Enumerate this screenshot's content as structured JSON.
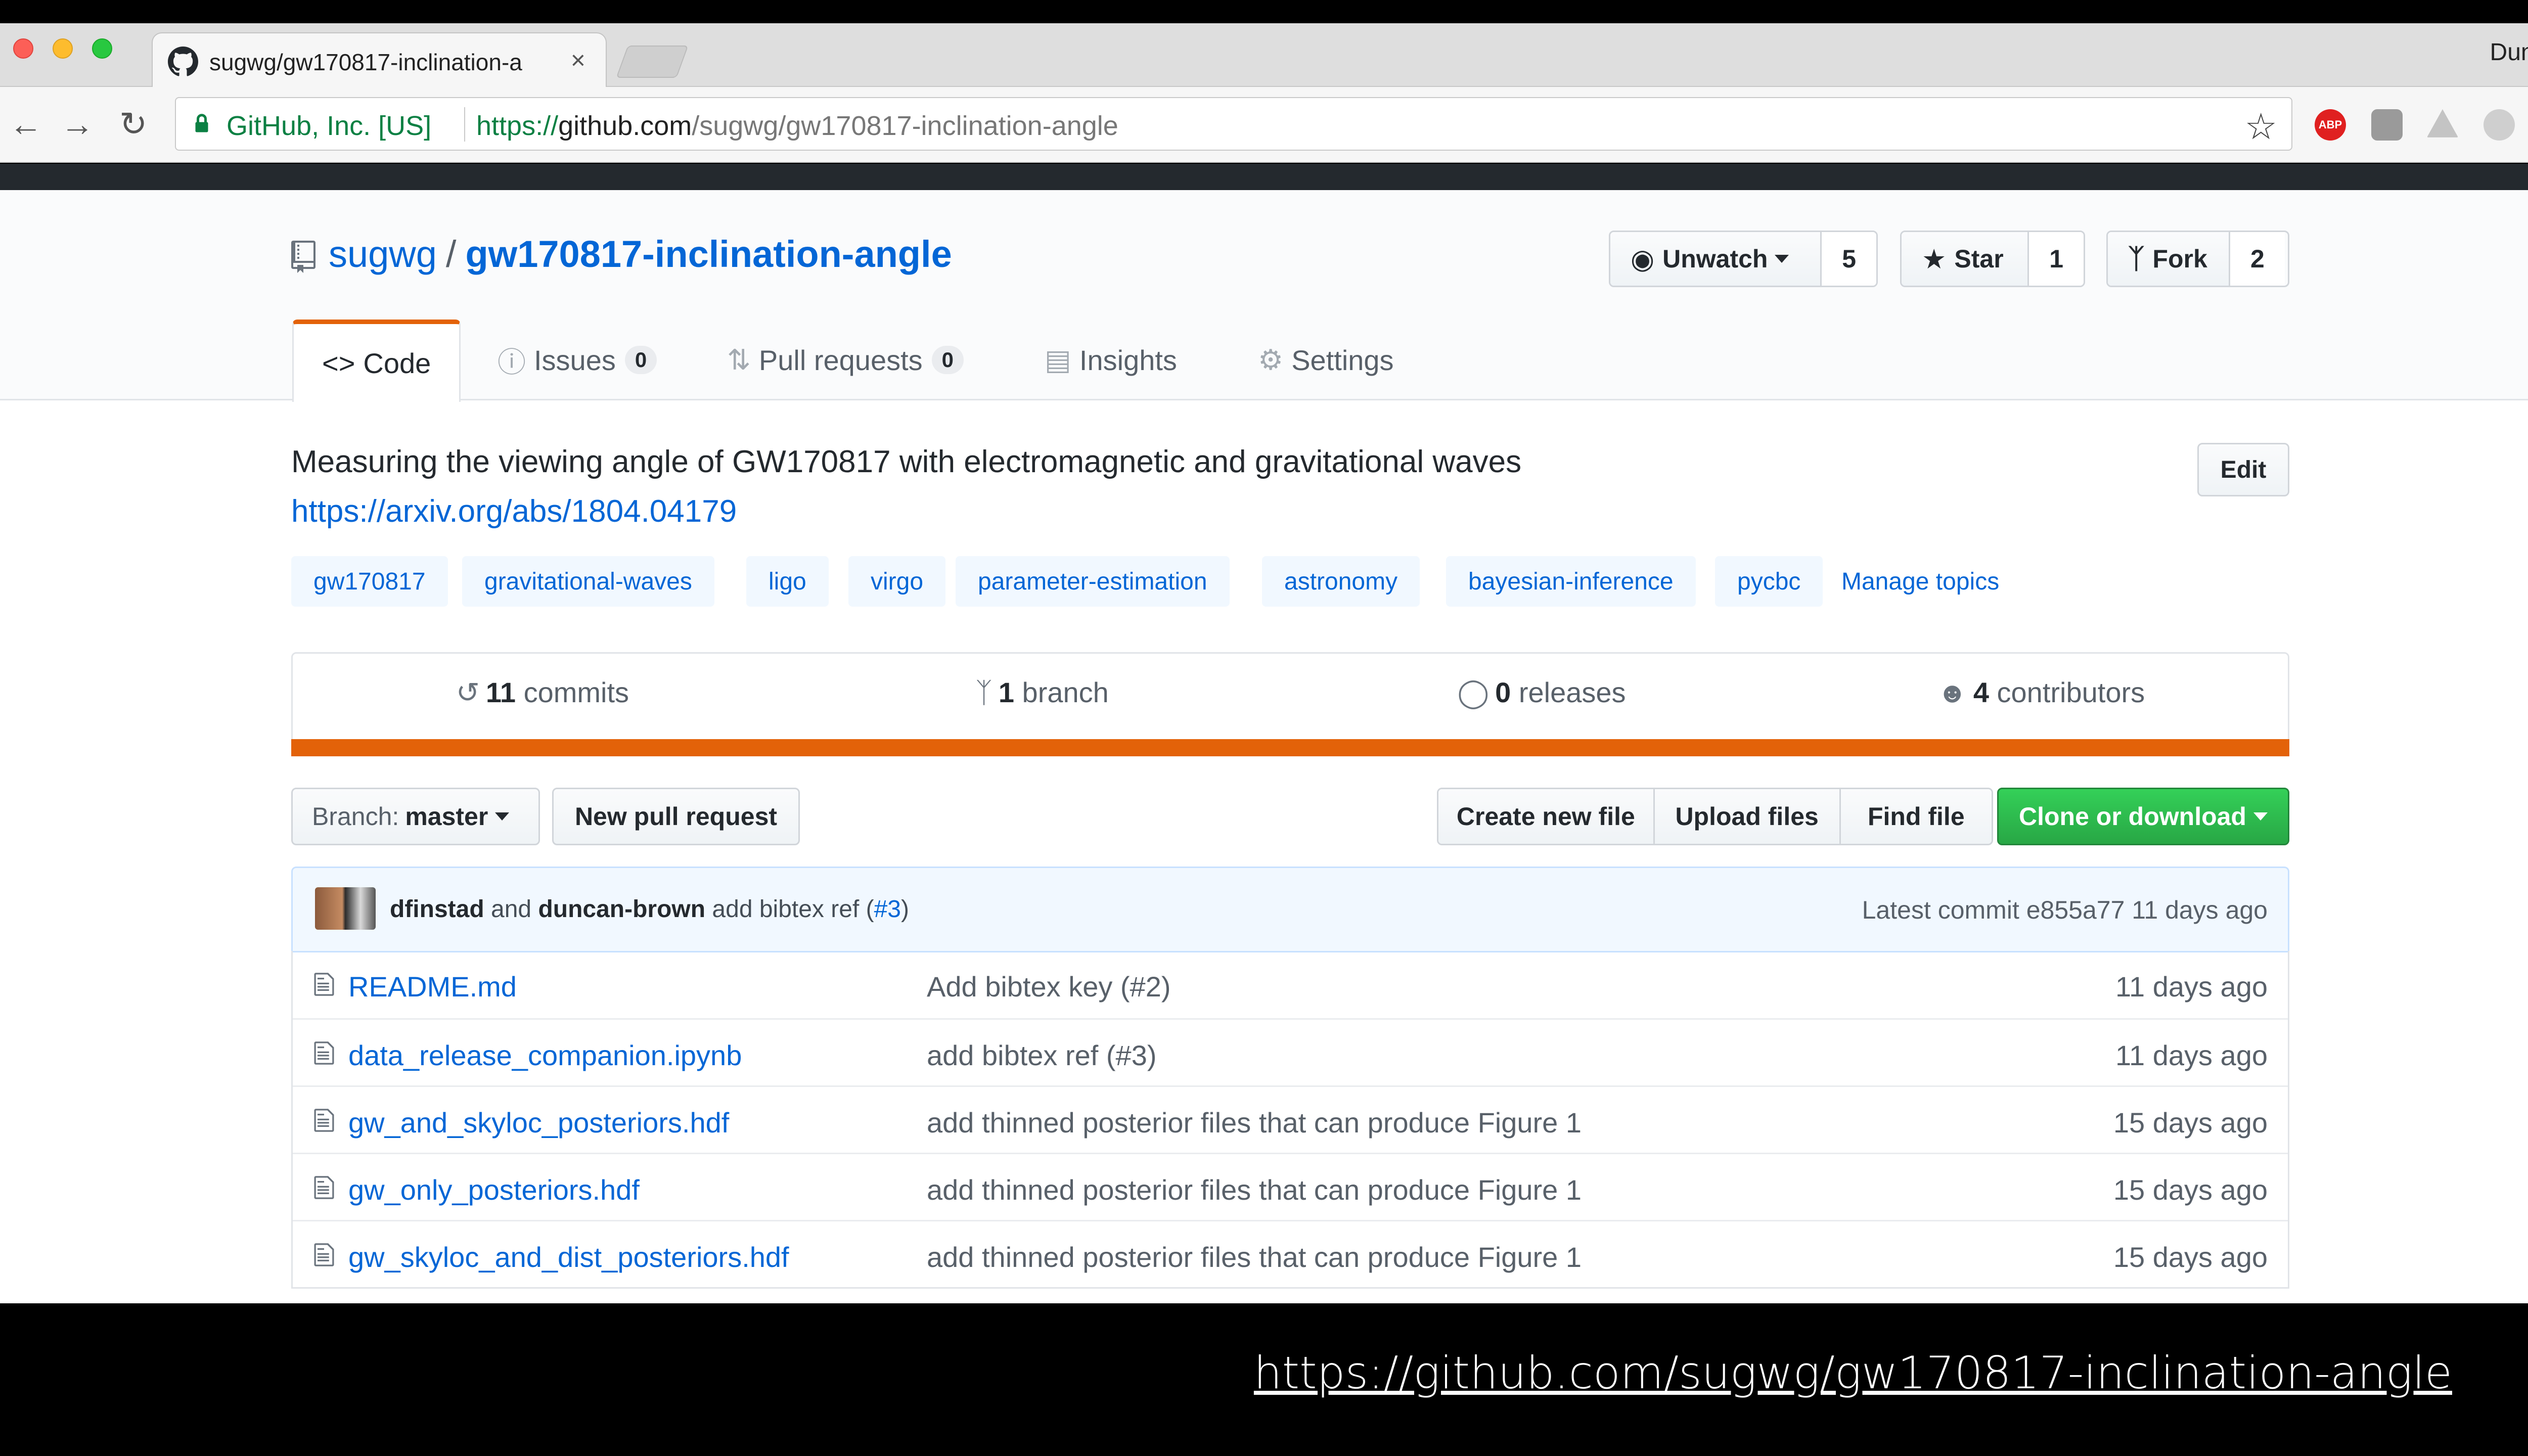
{
  "browser": {
    "tab_title": "sugwg/gw170817-inclination-a",
    "tab_close": "×",
    "profile_name": "Duncan",
    "secure_label": "GitHub, Inc. [US]",
    "url_proto": "https://",
    "url_host": "github.com",
    "url_path": "/sugwg/gw170817-inclination-angle",
    "extensions": [
      "ABP"
    ]
  },
  "repo": {
    "owner": "sugwg",
    "separator": "/",
    "name": "gw170817-inclination-angle",
    "watch_label": "Unwatch",
    "watch_count": "5",
    "star_label": "Star",
    "star_count": "1",
    "fork_label": "Fork",
    "fork_count": "2"
  },
  "nav": {
    "code": "Code",
    "issues": "Issues",
    "issues_count": "0",
    "pulls": "Pull requests",
    "pulls_count": "0",
    "insights": "Insights",
    "settings": "Settings"
  },
  "about": {
    "description": "Measuring the viewing angle of GW170817 with electromagnetic and gravitational waves",
    "homepage": "https://arxiv.org/abs/1804.04179",
    "edit_label": "Edit",
    "topics": [
      "gw170817",
      "gravitational-waves",
      "ligo",
      "virgo",
      "parameter-estimation",
      "astronomy",
      "bayesian-inference",
      "pycbc"
    ],
    "manage_topics": "Manage topics"
  },
  "summary": {
    "commits_num": "11",
    "commits_label": "commits",
    "branch_num": "1",
    "branch_label": "branch",
    "releases_num": "0",
    "releases_label": "releases",
    "contributors_num": "4",
    "contributors_label": "contributors",
    "language_color": "#e36209"
  },
  "filenav": {
    "branch_prefix": "Branch:",
    "branch_name": "master",
    "new_pr": "New pull request",
    "create_file": "Create new file",
    "upload_files": "Upload files",
    "find_file": "Find file",
    "clone": "Clone or download"
  },
  "latest_commit": {
    "author1": "dfinstad",
    "and": "and",
    "author2": "duncan-brown",
    "message": "add bibtex ref (",
    "ref": "#3",
    "message_end": ")",
    "meta": "Latest commit e855a77 11 days ago"
  },
  "files": [
    {
      "name": "README.md",
      "message": "Add bibtex key (#2)",
      "age": "11 days ago"
    },
    {
      "name": "data_release_companion.ipynb",
      "message": "add bibtex ref (#3)",
      "age": "11 days ago"
    },
    {
      "name": "gw_and_skyloc_posteriors.hdf",
      "message": "add thinned posterior files that can produce Figure 1",
      "age": "15 days ago"
    },
    {
      "name": "gw_only_posteriors.hdf",
      "message": "add thinned posterior files that can produce Figure 1",
      "age": "15 days ago"
    },
    {
      "name": "gw_skyloc_and_dist_posteriors.hdf",
      "message": "add thinned posterior files that can produce Figure 1",
      "age": "15 days ago"
    }
  ],
  "caption": "https://github.com/sugwg/gw170817-inclination-angle"
}
